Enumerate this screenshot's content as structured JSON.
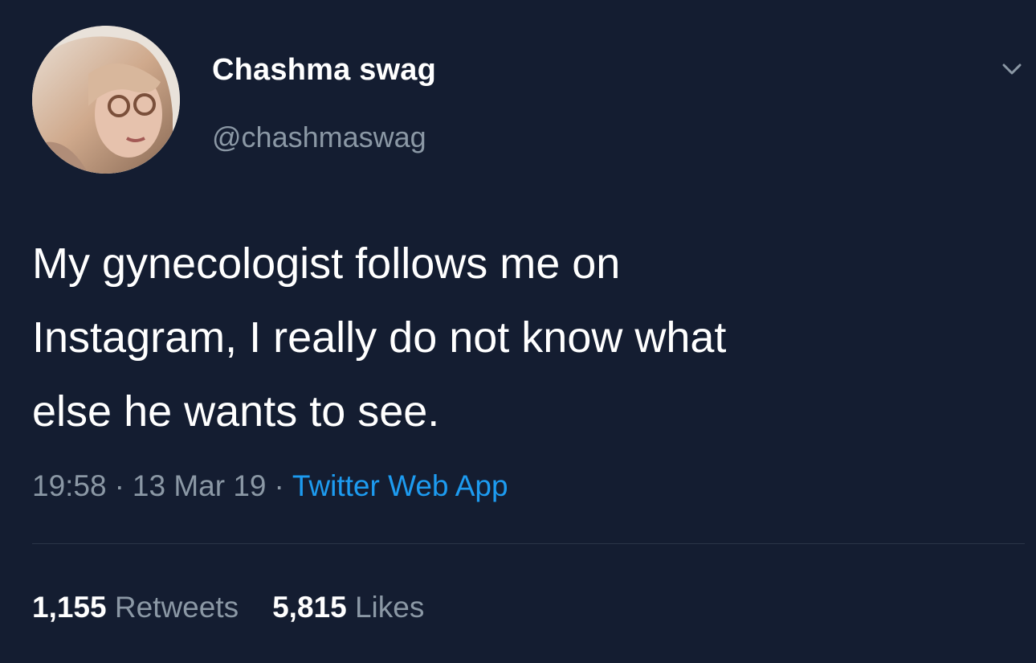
{
  "tweet": {
    "author": {
      "display_name": "Chashma swag",
      "handle": "@chashmaswag",
      "avatar_icon": "user-avatar-photo"
    },
    "menu_icon": "chevron-down-icon",
    "text_lines": [
      "My gynecologist follows me on",
      "Instagram, I really do not know what",
      "else he wants to see."
    ],
    "meta": {
      "time": "19:58",
      "separator": "·",
      "date": "13 Mar 19",
      "source": "Twitter Web App"
    },
    "stats": {
      "retweets_count": "1,155",
      "retweets_label": "Retweets",
      "likes_count": "5,815",
      "likes_label": "Likes"
    }
  },
  "colors": {
    "background": "#141d31",
    "primary_text": "#ffffff",
    "secondary_text": "#8b98a5",
    "link": "#1d9bf0"
  }
}
